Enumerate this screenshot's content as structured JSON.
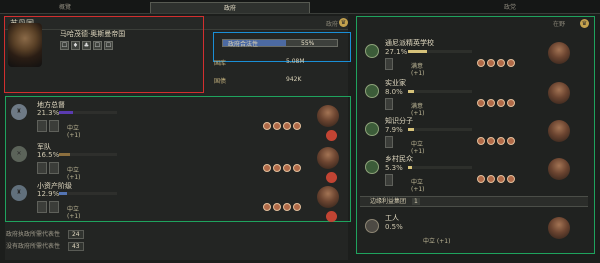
{
  "tabs": [
    {
      "label": "概覽"
    },
    {
      "label": "政府",
      "active": true
    },
    {
      "label": "政党"
    }
  ],
  "ruler": {
    "name": "苏丹国",
    "gov_label": "政府",
    "traits": [
      "☐",
      "♦",
      "♣",
      "☐",
      "☐"
    ],
    "title": "马哈茂德·奥斯曼帝国"
  },
  "legitimacy": {
    "label": "政府合法性",
    "value": "55%",
    "fill": 0.55
  },
  "stats": [
    {
      "label": "国库",
      "value": "5.08M"
    },
    {
      "label": "国债",
      "value": "942K"
    }
  ],
  "groups": [
    {
      "name": "地方总督",
      "pct": "21.3%",
      "approve": "中立 (+1)",
      "color": "#5a3bb0",
      "fill": 0.24
    },
    {
      "name": "军队",
      "pct": "16.5%",
      "approve": "中立 (+1)",
      "color": "#8c6f3e",
      "fill": 0.19
    },
    {
      "name": "小资产阶级",
      "pct": "12.9%",
      "approve": "中立 (+1)",
      "color": "#5475b4",
      "fill": 0.14
    }
  ],
  "right": {
    "header": "在野",
    "groups": [
      {
        "name": "通尼派精英学校",
        "pct": "27.1%",
        "approve": "满意 (+1)",
        "fill": 0.29
      },
      {
        "name": "实业家",
        "pct": "8.0%",
        "approve": "满意 (+1)",
        "fill": 0.09
      },
      {
        "name": "知识分子",
        "pct": "7.9%",
        "approve": "中立 (+1)",
        "fill": 0.09
      },
      {
        "name": "乡村民众",
        "pct": "5.3%",
        "approve": "中立 (+1)",
        "fill": 0.06
      }
    ],
    "marginal_label": "边缘利益集团",
    "marginal_count": "1",
    "worker": {
      "name": "工人",
      "pct": "0.5%",
      "approve": "中立 (+1)"
    }
  },
  "footer": [
    {
      "label": "政府执政所需代表性",
      "value": "24"
    },
    {
      "label": "没有政府所需代表性",
      "value": "43"
    }
  ]
}
